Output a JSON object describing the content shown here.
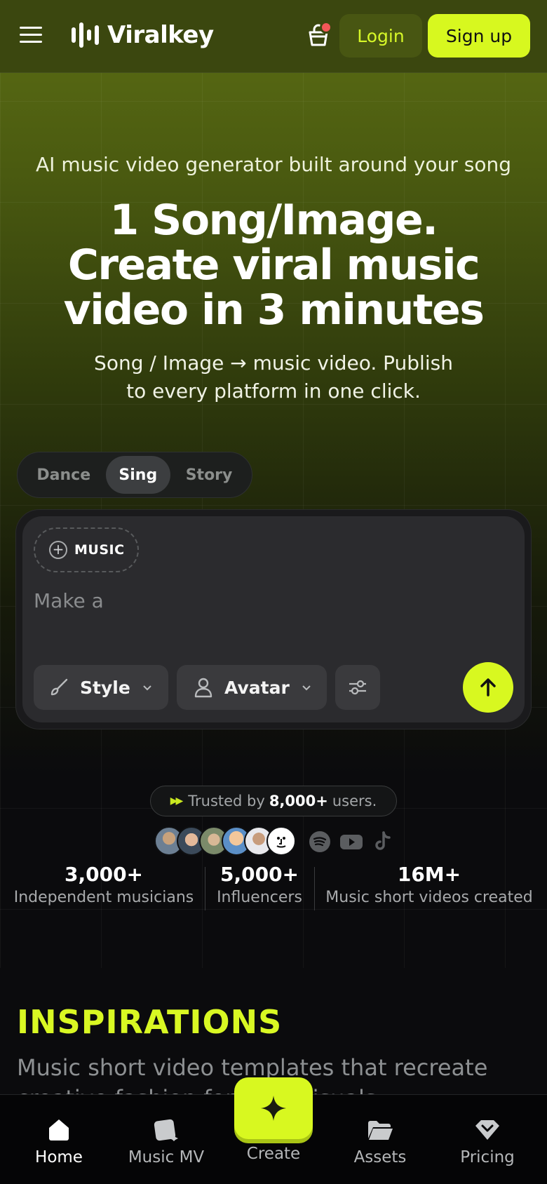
{
  "header": {
    "brand": "Viralkey",
    "login_label": "Login",
    "signup_label": "Sign up"
  },
  "hero": {
    "eyebrow": "AI music video generator built around your song",
    "headline_lines": [
      "1 Song/Image.",
      "Create viral music",
      "video in 3 minutes"
    ],
    "subhead_lines": [
      "Song / Image → music video. Publish",
      "to every platform in one click."
    ]
  },
  "mode_tabs": [
    {
      "label": "Dance",
      "active": false
    },
    {
      "label": "Sing",
      "active": true
    },
    {
      "label": "Story",
      "active": false
    }
  ],
  "composer": {
    "music_chip_label": "MUSIC",
    "prompt_placeholder": "Make a",
    "style_label": "Style",
    "avatar_label": "Avatar"
  },
  "trust": {
    "prefix": "Trusted by",
    "count": "8,000+",
    "suffix": "users.",
    "platforms": [
      "spotify-icon",
      "youtube-icon",
      "tiktok-icon"
    ]
  },
  "stats": [
    {
      "number": "3,000+",
      "caption": "Independent musicians"
    },
    {
      "number": "5,000+",
      "caption": "Influencers"
    },
    {
      "number": "16M+",
      "caption": "Music short videos created"
    }
  ],
  "inspirations": {
    "title": "INSPIRATIONS",
    "description": "Music short video templates that recreate creative fashion for your visuals."
  },
  "bottom_nav": [
    {
      "label": "Home",
      "icon": "home-icon",
      "active": true
    },
    {
      "label": "Music MV",
      "icon": "music-mv-icon",
      "active": false
    },
    {
      "label": "Create",
      "icon": "sparkle-icon",
      "active": false
    },
    {
      "label": "Assets",
      "icon": "folder-icon",
      "active": false
    },
    {
      "label": "Pricing",
      "icon": "tag-icon",
      "active": false
    }
  ],
  "colors": {
    "accent": "#d8f820",
    "header_bg": "#3b470f",
    "notification_dot": "#f25757"
  }
}
